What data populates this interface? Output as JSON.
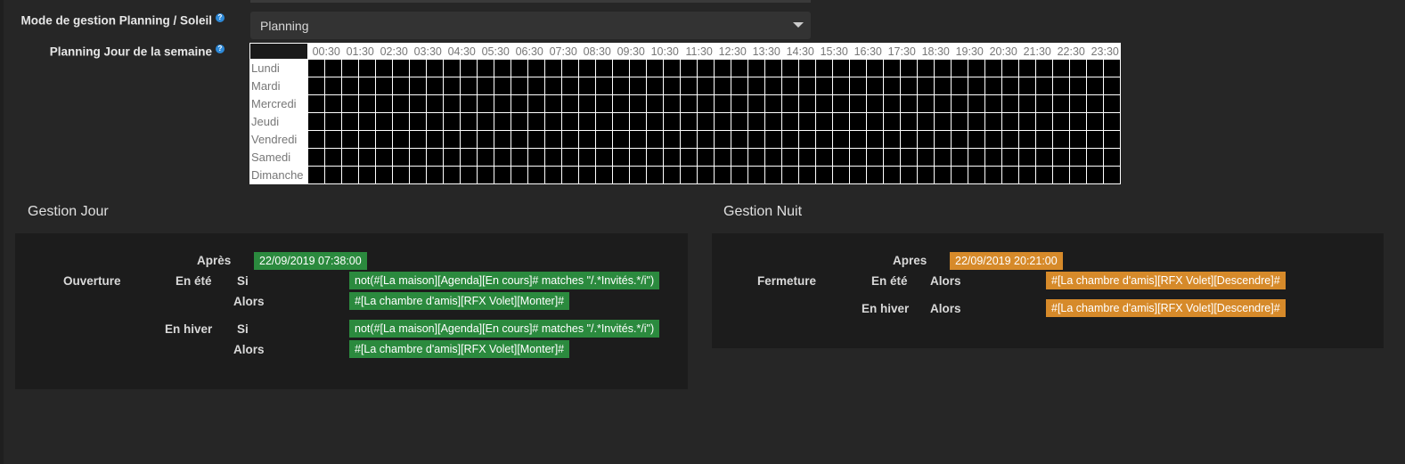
{
  "form": {
    "mode_label": "Mode de gestion Planning / Soleil",
    "mode_value": "Planning",
    "planning_label": "Planning Jour de la semaine"
  },
  "grid": {
    "hours": [
      "00",
      "01",
      "02",
      "03",
      "04",
      "05",
      "06",
      "07",
      "08",
      "09",
      "10",
      "11",
      "12",
      "13",
      "14",
      "15",
      "16",
      "17",
      "18",
      "19",
      "20",
      "21",
      "22",
      "23"
    ],
    "half_label": ":30",
    "days": [
      "Lundi",
      "Mardi",
      "Mercredi",
      "Jeudi",
      "Vendredi",
      "Samedi",
      "Dimanche"
    ]
  },
  "jour": {
    "title": "Gestion Jour",
    "apres_label": "Après",
    "apres_value": "22/09/2019 07:38:00",
    "ouverture_label": "Ouverture",
    "ete_label": "En été",
    "ete_si_label": "Si",
    "ete_si_value": "not(#[La maison][Agenda][En cours]# matches \"/.*Invités.*/i\")",
    "ete_alors_label": "Alors",
    "ete_alors_value": "#[La chambre d'amis][RFX Volet][Monter]#",
    "hiver_label": "En hiver",
    "hiver_si_label": "Si",
    "hiver_si_value": "not(#[La maison][Agenda][En cours]# matches \"/.*Invités.*/i\")",
    "hiver_alors_label": "Alors",
    "hiver_alors_value": "#[La chambre d'amis][RFX Volet][Monter]#"
  },
  "nuit": {
    "title": "Gestion Nuit",
    "apres_label": "Apres",
    "apres_value": "22/09/2019 20:21:00",
    "fermeture_label": "Fermeture",
    "ete_label": "En été",
    "ete_alors_label": "Alors",
    "ete_alors_value": "#[La chambre d'amis][RFX Volet][Descendre]#",
    "hiver_label": "En hiver",
    "hiver_alors_label": "Alors",
    "hiver_alors_value": "#[La chambre d'amis][RFX Volet][Descendre]#"
  },
  "colors": {
    "green_badge": "#2b8a3e",
    "orange_badge": "#d68a2a",
    "help_icon": "#2e8ad9"
  }
}
